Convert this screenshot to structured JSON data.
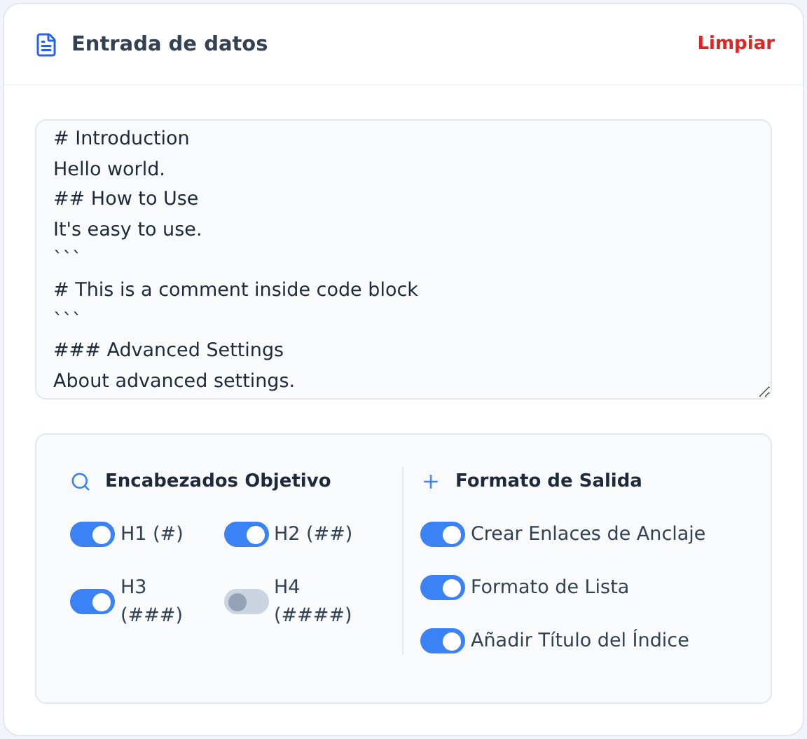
{
  "header": {
    "title": "Entrada de datos",
    "clear_button": "Limpiar"
  },
  "editor": {
    "value": "# Introduction\nHello world.\n## How to Use\nIt's easy to use.\n```\n# This is a comment inside code block\n```\n### Advanced Settings\nAbout advanced settings."
  },
  "options": {
    "headings": {
      "title": "Encabezados Objetivo",
      "items": [
        {
          "label": "H1 (#)",
          "on": true
        },
        {
          "label": "H2 (##)",
          "on": true
        },
        {
          "label": "H3 (###)",
          "on": true
        },
        {
          "label": "H4 (####)",
          "on": false
        }
      ]
    },
    "output": {
      "title": "Formato de Salida",
      "items": [
        {
          "label": "Crear Enlaces de Anclaje",
          "on": true
        },
        {
          "label": "Formato de Lista",
          "on": true
        },
        {
          "label": "Añadir Título del Índice",
          "on": true
        }
      ]
    }
  }
}
